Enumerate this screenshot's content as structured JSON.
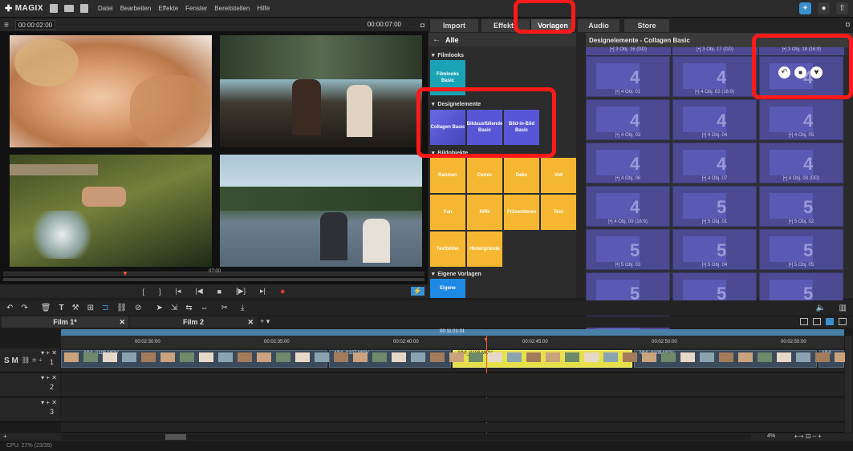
{
  "app": {
    "logo": "MAGIX",
    "menus": [
      "Datei",
      "Bearbeiten",
      "Effekte",
      "Fenster",
      "Bereitstellen",
      "Hilfe"
    ]
  },
  "preview": {
    "timecode_left": "00:00:02:00",
    "timecode_right": "00:00:07:00",
    "scrub_label": "07:00"
  },
  "panel": {
    "tabs": [
      "Import",
      "Effekte",
      "Vorlagen",
      "Audio",
      "Store"
    ],
    "active_tab": "Vorlagen",
    "back_label": "Alle",
    "sections": {
      "filmlooks": "Filmlooks",
      "designelemente": "Designelemente",
      "bildobjekte": "Bildobjekte",
      "eigene": "Eigene Vorlagen"
    },
    "filmlooks_tiles": [
      "Filmlooks Basic"
    ],
    "design_tiles": [
      "Collagen Basic",
      "Bildausfüllende Basic",
      "Bild-in-Bild Basic"
    ],
    "bild_tiles": [
      "Rahmen",
      "Comic",
      "Deko",
      "Voll",
      "Fan",
      "Hilfe",
      "Präsentieren",
      "Text",
      "Textbilder",
      "Hintergründe"
    ],
    "eigene_tile": "Eigene",
    "grid_title": "Designelemente - Collagen Basic",
    "grid_headers": [
      "[•] 3 Obj.   16 (DD)",
      "[•] 3 Obj.   17 (DD)",
      "[•] 3 Obj.   18 (16:9)"
    ],
    "grid_cells": [
      {
        "label": "[•] 4 Obj.   01",
        "num": "4"
      },
      {
        "label": "[•] 4 Obj.   02 (16:9)",
        "num": "4"
      },
      {
        "label": "",
        "num": "4"
      },
      {
        "label": "[•] 4 Obj.   03",
        "num": "4"
      },
      {
        "label": "[•] 4 Obj.   04",
        "num": "4"
      },
      {
        "label": "[•] 4 Obj.   05",
        "num": "4"
      },
      {
        "label": "[•] 4 Obj.   06",
        "num": "4"
      },
      {
        "label": "[•] 4 Obj.   07",
        "num": "4"
      },
      {
        "label": "[•] 4 Obj.   08 (DD)",
        "num": "4"
      },
      {
        "label": "[•] 4 Obj.   09 (16:9)",
        "num": "4"
      },
      {
        "label": "[•] 5 Obj.   01",
        "num": "5"
      },
      {
        "label": "[•] 5 Obj.   02",
        "num": "5"
      },
      {
        "label": "[•] 5 Obj.   03",
        "num": "5"
      },
      {
        "label": "[•] 5 Obj.   04",
        "num": "5"
      },
      {
        "label": "[•] 5 Obj.   05",
        "num": "5"
      },
      {
        "label": "[•] 5 Obj.   06",
        "num": "5"
      },
      {
        "label": "",
        "num": "5"
      },
      {
        "label": "",
        "num": "5"
      },
      {
        "label": "",
        "num": "5"
      }
    ]
  },
  "timeline": {
    "film_tabs": [
      "Film 1*",
      "Film 2"
    ],
    "overview_time": "00:11:21:01",
    "ruler_marks": [
      "00:02:30:00",
      "00:02:35:00",
      "00:02:40:00",
      "00:02:45:00",
      "00:02:50:00",
      "00:02:55:00"
    ],
    "clips": [
      "MVI_0106.MOV",
      "MVI_0107.MOV",
      "MVI_0108.MOV",
      "MVI_0109.MOV",
      "MVI"
    ],
    "track_numbers": [
      "1",
      "2",
      "3"
    ],
    "track_sm": "S M",
    "zoom": "4%"
  },
  "status": {
    "cpu": "CPU: 27% (23/35)"
  },
  "colors": {
    "accent": "#3a8fd0",
    "highlight": "#ff1a1a",
    "design_tile": "#5856d6",
    "bild_tile": "#f5b731",
    "clip_selected": "#e6e04a"
  }
}
